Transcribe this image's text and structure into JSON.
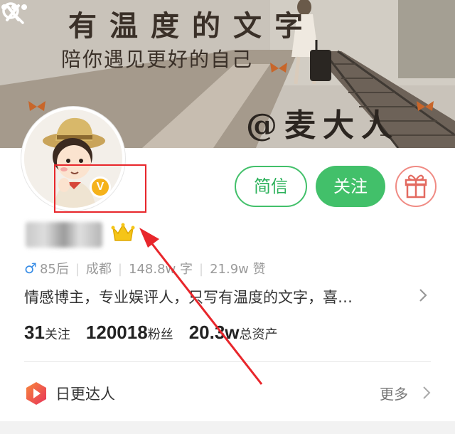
{
  "banner": {
    "title": "有温度的文字",
    "subtitle": "陪你遇见更好的自己",
    "watermark": "@麦大人"
  },
  "header": {
    "icons": [
      "back-icon",
      "search-icon",
      "more-icon"
    ]
  },
  "profile": {
    "verified_badge": "V",
    "actions": {
      "message_label": "简信",
      "follow_label": "关注",
      "gift_icon": "gift-icon"
    },
    "meta": {
      "age": "85后",
      "city": "成都",
      "words": "148.8w 字",
      "likes": "21.9w 赞"
    },
    "bio": "情感博主，专业娱评人，只写有温度的文字，喜…",
    "stats": [
      {
        "num": "31",
        "label": "关注"
      },
      {
        "num": "120018",
        "label": "粉丝"
      },
      {
        "num": "20.3w",
        "label": "总资产"
      }
    ],
    "daily": {
      "label": "日更达人",
      "more_label": "更多"
    }
  },
  "colors": {
    "accent_green": "#42c06a",
    "annotation_red": "#e8262b",
    "badge_gold": "#f5b21b"
  }
}
